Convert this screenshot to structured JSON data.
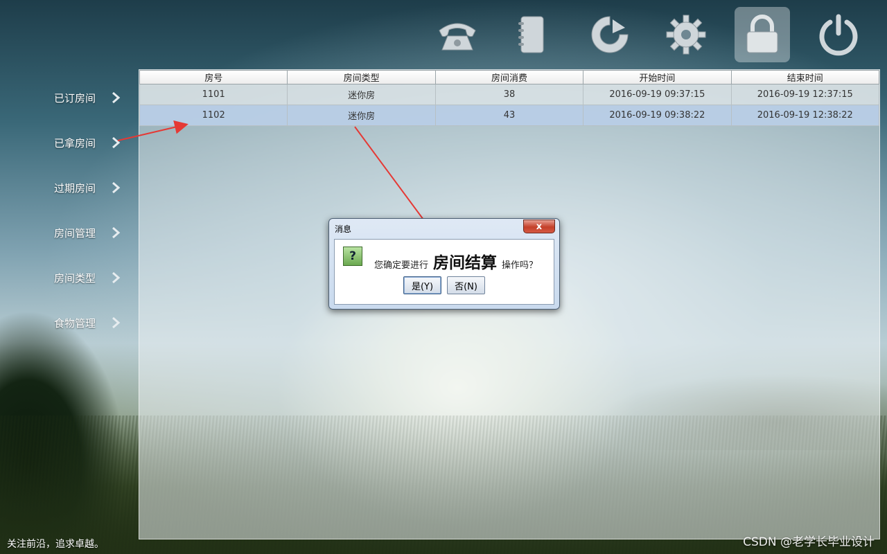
{
  "toolbar": {
    "icons": [
      "phone-icon",
      "address-book-icon",
      "refresh-icon",
      "gear-icon",
      "lock-icon",
      "power-icon"
    ],
    "active_icon": "lock-icon"
  },
  "sidebar": {
    "items": [
      {
        "label": "已订房间"
      },
      {
        "label": "已拿房间"
      },
      {
        "label": "过期房间"
      },
      {
        "label": "房间管理"
      },
      {
        "label": "房间类型"
      },
      {
        "label": "食物管理"
      }
    ]
  },
  "table": {
    "columns": [
      "房号",
      "房间类型",
      "房间消费",
      "开始时间",
      "结束时间"
    ],
    "rows": [
      [
        "1101",
        "迷你房",
        "38",
        "2016-09-19 09:37:15",
        "2016-09-19 12:37:15"
      ],
      [
        "1102",
        "迷你房",
        "43",
        "2016-09-19 09:38:22",
        "2016-09-19 12:38:22"
      ]
    ],
    "selected_row": 1
  },
  "dialog": {
    "title": "消息",
    "close": "x",
    "icon": "question-icon",
    "icon_glyph": "?",
    "message_prefix": "您确定要进行",
    "message_strong": "房间结算",
    "message_suffix": "操作吗？",
    "yes_label": "是(Y)",
    "no_label": "否(N)"
  },
  "footer": {
    "slogan": "关注前沿，追求卓越。",
    "watermark": "CSDN @老学长毕业设计"
  },
  "colors": {
    "annotation_arrow": "#e53935",
    "selected_row": "#b8cde6"
  }
}
